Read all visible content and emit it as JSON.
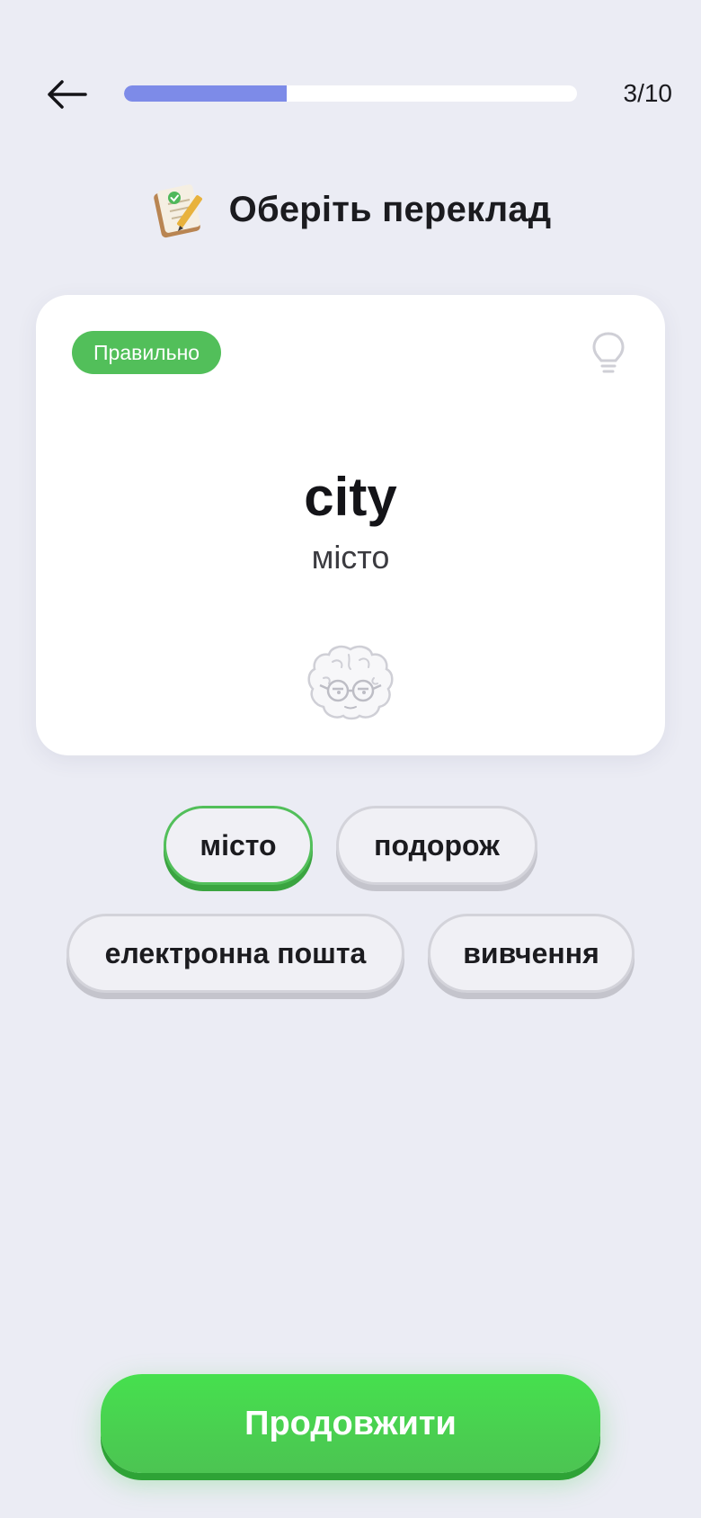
{
  "header": {
    "progress_text": "3/10",
    "progress_fraction": 0.3
  },
  "title": {
    "text": "Оберіть переклад",
    "icon": "notebook-pencil-icon"
  },
  "card": {
    "badge": "Правильно",
    "word": "city",
    "translation": "місто",
    "hint_icon": "lightbulb-icon",
    "mascot_icon": "brain-with-glasses-icon"
  },
  "options": [
    {
      "label": "місто",
      "state": "correct"
    },
    {
      "label": "подорож",
      "state": "default"
    },
    {
      "label": "електронна пошта",
      "state": "default"
    },
    {
      "label": "вивчення",
      "state": "default"
    }
  ],
  "footer": {
    "continue_label": "Продовжити"
  },
  "colors": {
    "background": "#ebecf4",
    "progress": "#7d8be8",
    "correct": "#52bf5a",
    "continue": "#46e04e"
  }
}
